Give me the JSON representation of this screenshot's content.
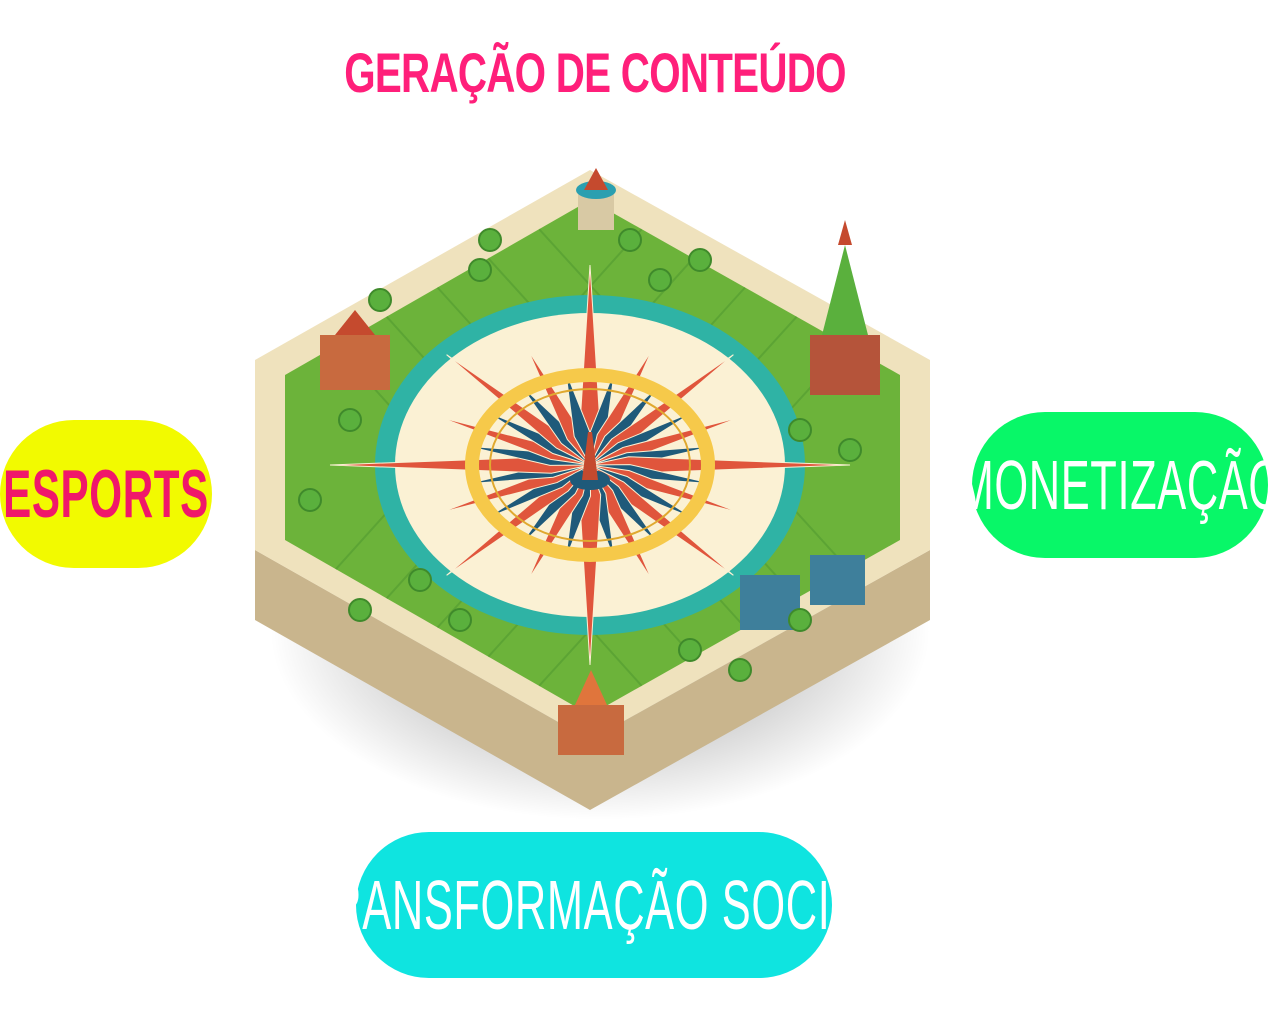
{
  "headline": {
    "text": "GERAÇÃO DE CONTEÚDO",
    "color": "#ff1f7a"
  },
  "pills": {
    "esports": {
      "label": "ESPORTS",
      "bg": "#f2fa00",
      "text_color": "#f0176a"
    },
    "monetizacao": {
      "label": "MONETIZAÇÃO",
      "bg": "#08f768",
      "text_color": "#ffffff"
    },
    "transformacao": {
      "label": "TRANSFORMAÇÃO SOCIAL",
      "bg": "#0fe4e0",
      "text_color": "#ffffff"
    }
  },
  "illustration": {
    "subject": "isometric-compass-board-icon",
    "palette": {
      "stone": "#efe2bd",
      "stone_dark": "#c9b58d",
      "grass": "#6cb33a",
      "grass_dark": "#3f8a2b",
      "water": "#2fb3a5",
      "sand": "#f4d68a",
      "compass_face": "#fbf1d4",
      "ring_gold": "#f6c94a",
      "ray_red": "#e0553c",
      "ray_blue": "#1f5a7a",
      "roof": "#c54a2e",
      "tower_green": "#5ab03d"
    }
  }
}
